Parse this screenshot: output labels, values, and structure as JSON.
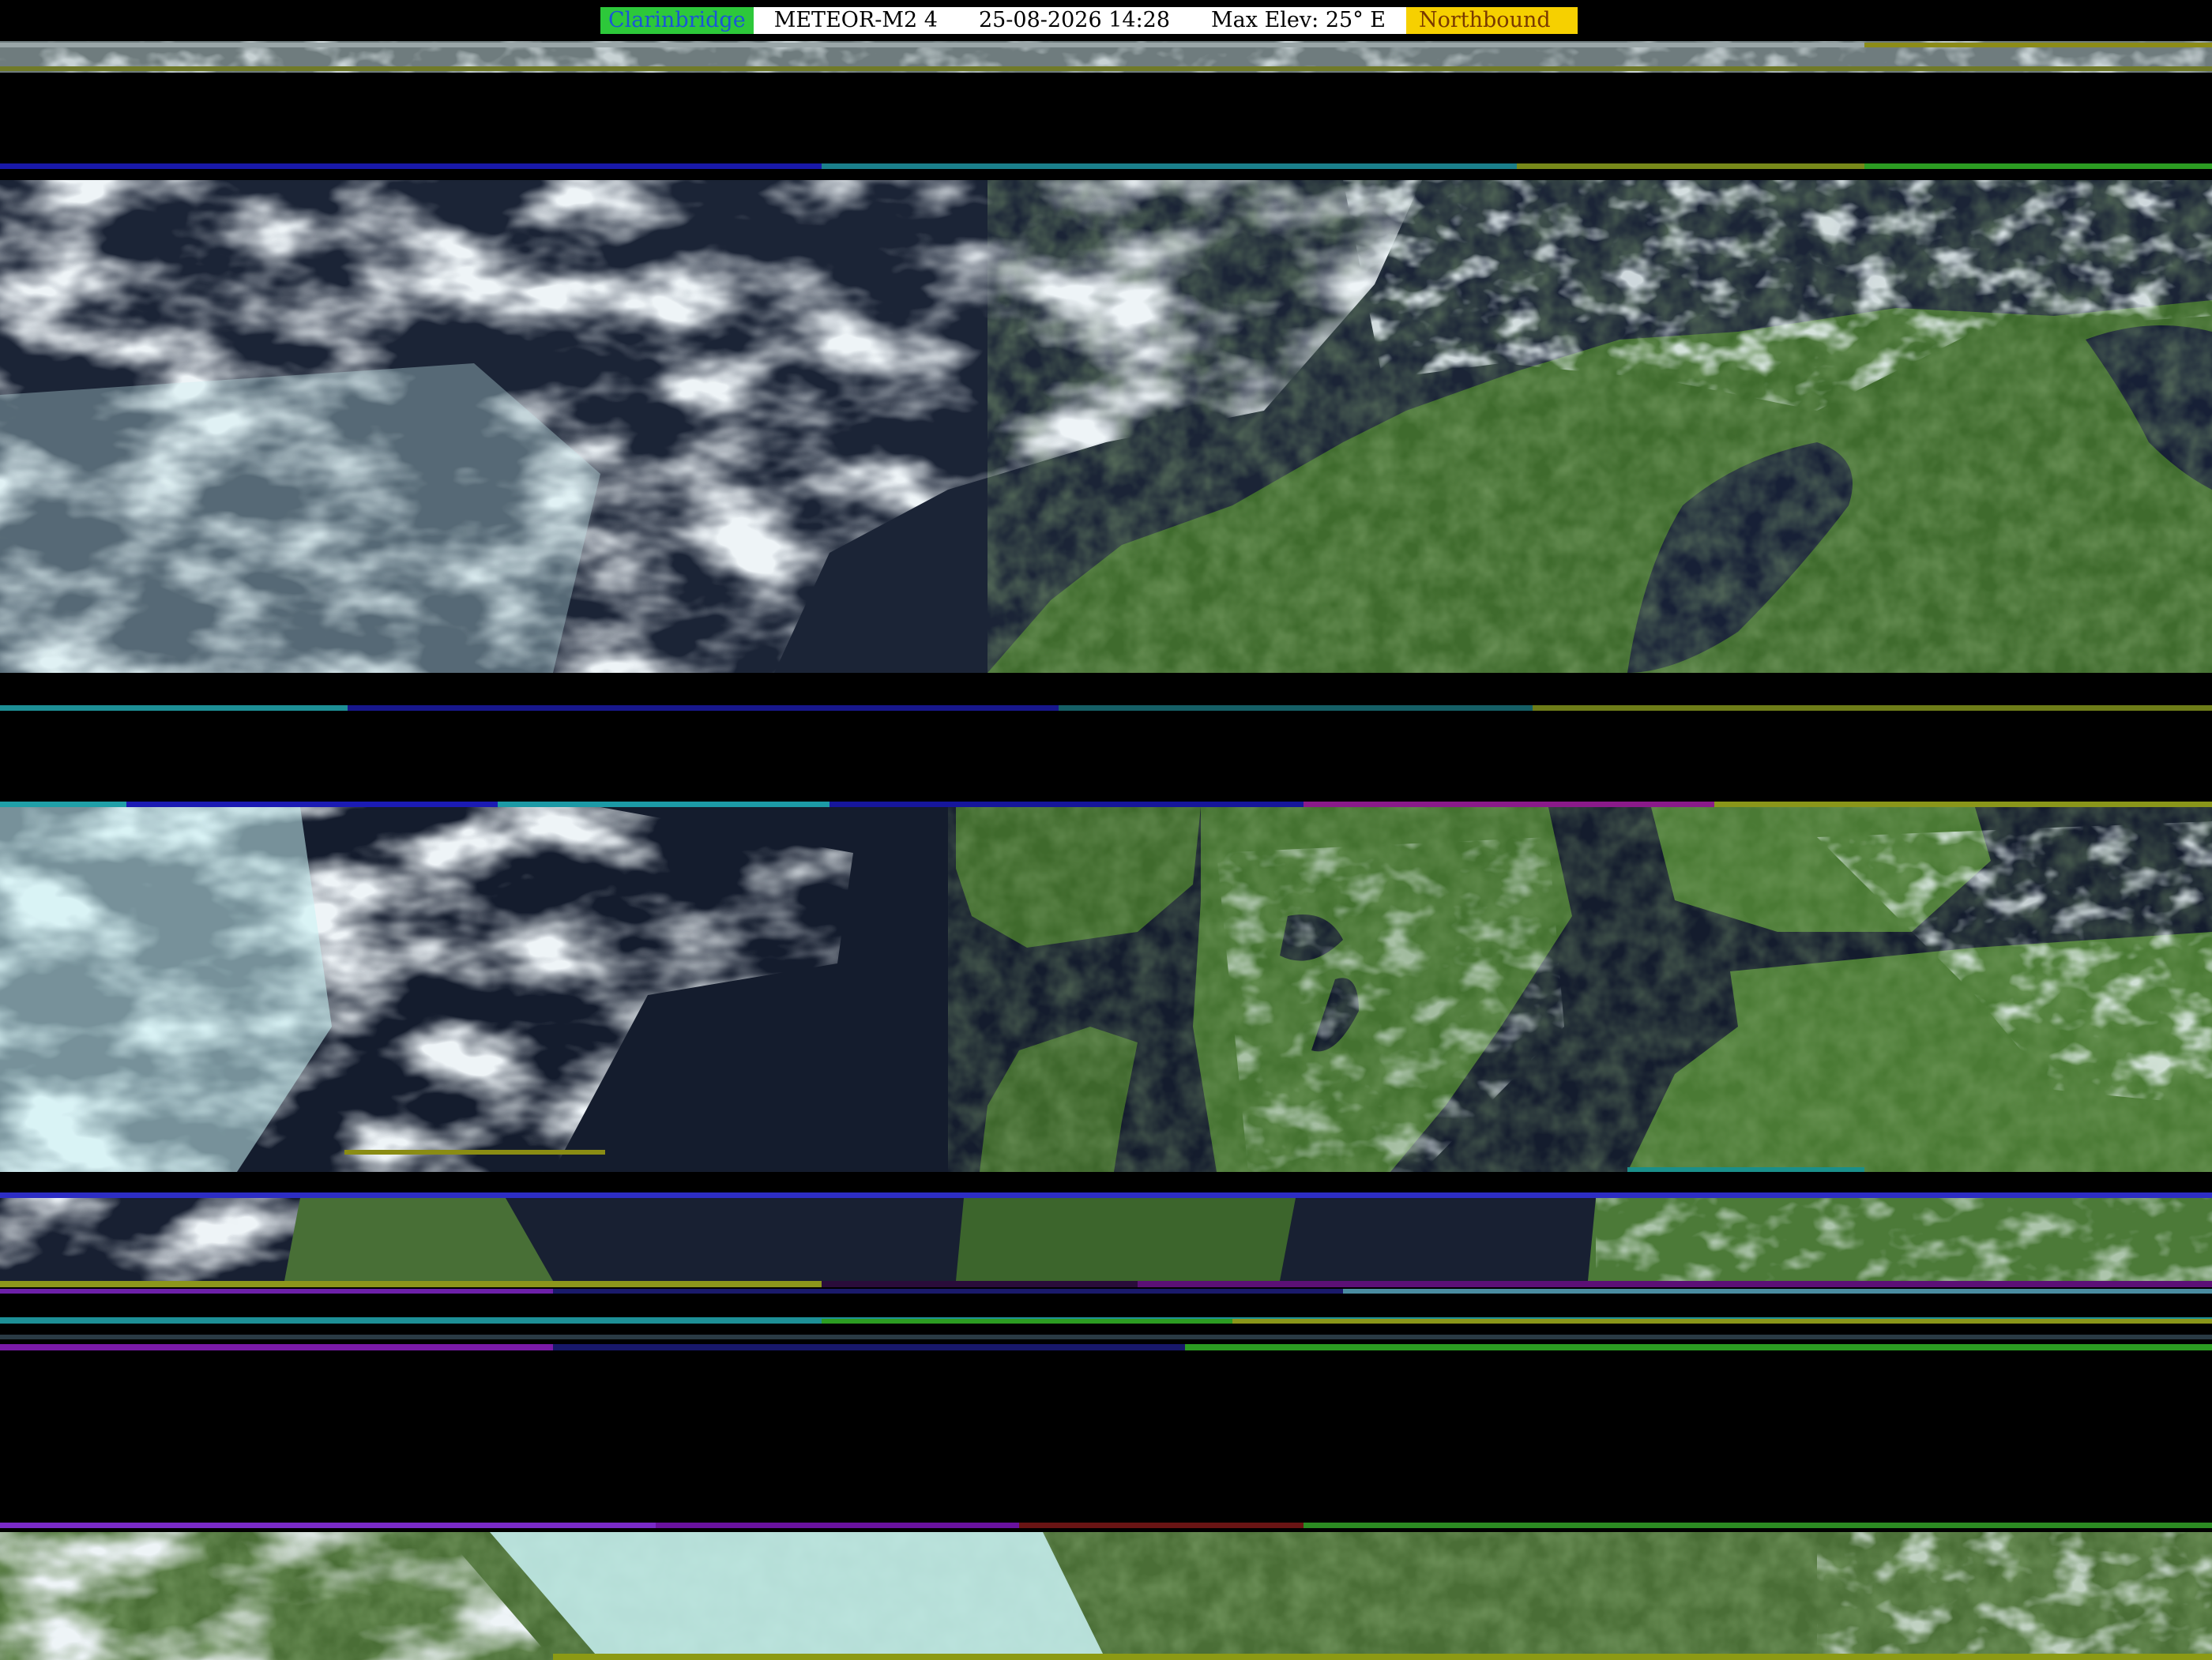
{
  "overlay": {
    "station": "Clarinbridge",
    "satellite": "METEOR-M2 4",
    "datetime": "25-08-2026 14:28",
    "max_elevation": "Max Elev: 25° E",
    "direction": "Northbound"
  },
  "colors": {
    "background": "#000000",
    "station_bg": "#2dc83a",
    "station_text": "#1a56d6",
    "direction_bg": "#f6d000",
    "cloud": "#d8e6ee",
    "cloud_cyan": "#bfeeee",
    "sea": "#141c2c",
    "land": "#3d6a2e"
  },
  "image": {
    "type": "satellite-imagery",
    "description_hidden": false
  }
}
